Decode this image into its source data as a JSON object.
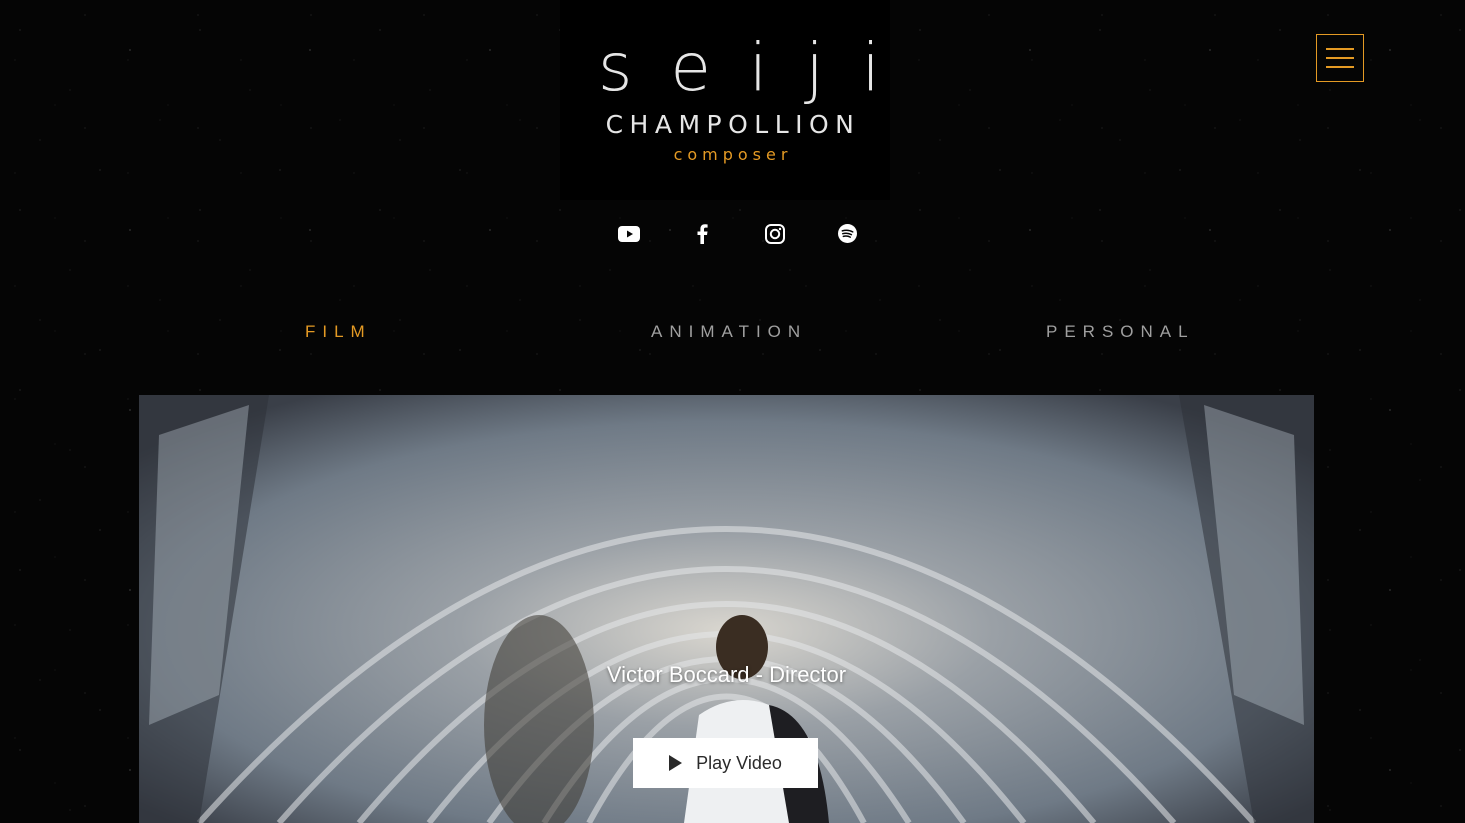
{
  "logo": {
    "name_first": "seiji",
    "name_last": "CHAMPOLLION",
    "role": "composer"
  },
  "social": {
    "icons": [
      "youtube-icon",
      "facebook-icon",
      "instagram-icon",
      "spotify-icon"
    ]
  },
  "menu": {
    "icon": "hamburger-menu-icon"
  },
  "nav": {
    "items": [
      {
        "label": "FILM",
        "active": true
      },
      {
        "label": "ANIMATION",
        "active": false
      },
      {
        "label": "PERSONAL",
        "active": false
      }
    ]
  },
  "video": {
    "title": "Victor Boccard - Director",
    "play_label": "Play Video"
  },
  "colors": {
    "accent": "#e49a24",
    "background": "#050505",
    "text": "#e6e6e6",
    "nav_inactive": "#a0a0a0"
  }
}
